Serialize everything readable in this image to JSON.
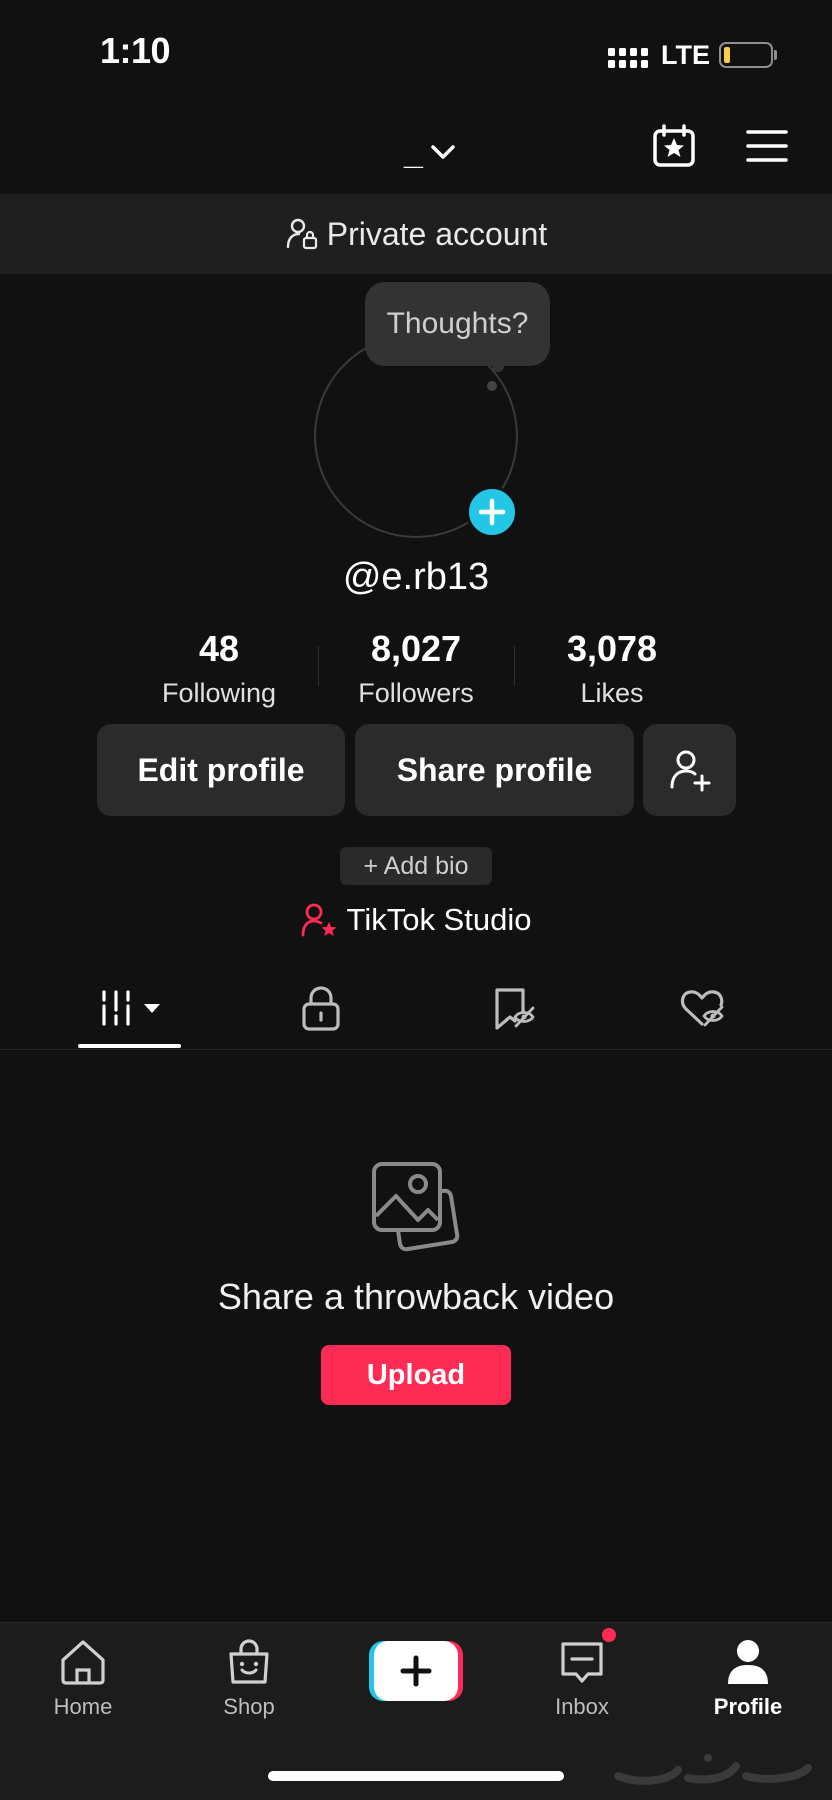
{
  "status_bar": {
    "time": "1:10",
    "network": "LTE",
    "battery_color": "#f7ce46"
  },
  "header": {
    "username_short": "_",
    "calendar_icon": "calendar-star-icon",
    "menu_icon": "hamburger-menu-icon"
  },
  "private_banner": {
    "label": "Private account",
    "icon": "person-lock-icon"
  },
  "avatar": {
    "thought_bubble": "Thoughts?",
    "accent": "#24c6e6"
  },
  "profile": {
    "handle": "@e.rb13"
  },
  "stats": [
    {
      "value": "48",
      "label": "Following"
    },
    {
      "value": "8,027",
      "label": "Followers"
    },
    {
      "value": "3,078",
      "label": "Likes"
    }
  ],
  "actions": {
    "edit_profile": "Edit profile",
    "share_profile": "Share profile",
    "add_friend_icon": "person-add-icon"
  },
  "bio": {
    "add_bio": "+ Add bio"
  },
  "studio": {
    "label": "TikTok Studio",
    "icon": "person-star-icon"
  },
  "tabs": [
    {
      "icon": "grid-dropdown-icon",
      "active": true
    },
    {
      "icon": "lock-icon",
      "active": false
    },
    {
      "icon": "bookmark-hidden-icon",
      "active": false
    },
    {
      "icon": "heart-hidden-icon",
      "active": false
    }
  ],
  "empty_state": {
    "title": "Share a throwback video",
    "upload": "Upload",
    "icon": "photos-icon"
  },
  "nav": {
    "items": [
      {
        "label": "Home",
        "icon": "home-icon"
      },
      {
        "label": "Shop",
        "icon": "shop-bag-icon"
      },
      {
        "label": "",
        "icon": "create-plus-icon"
      },
      {
        "label": "Inbox",
        "icon": "inbox-icon"
      },
      {
        "label": "Profile",
        "icon": "profile-icon"
      }
    ],
    "active": "Profile"
  },
  "colors": {
    "brand_red": "#fe2c55",
    "brand_cyan": "#24c6e6",
    "background": "#111111"
  }
}
